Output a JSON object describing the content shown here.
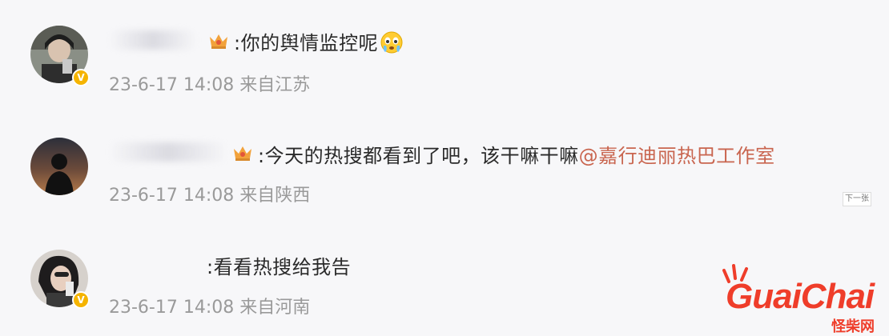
{
  "comments": [
    {
      "text": ":你的舆情监控呢",
      "emoji": "crying-face-emoji",
      "meta": "23-6-17 14:08 来自江苏"
    },
    {
      "text": ":今天的热搜都看到了吧，该干嘛干嘛",
      "mention": "@嘉行迪丽热巴工作室",
      "meta": "23-6-17 14:08 来自陕西"
    },
    {
      "text": ":看看热搜给我告",
      "meta": "23-6-17 14:08 来自河南"
    }
  ],
  "next_button": "下一张",
  "watermark": {
    "logo": "GuaiChai",
    "subtitle": "怪柴网"
  },
  "colors": {
    "mention": "#c9654f",
    "meta": "#9a9a9a",
    "text": "#2a2a2a",
    "logo": "#ef3d2a",
    "verified_badge": "#f5b400"
  }
}
